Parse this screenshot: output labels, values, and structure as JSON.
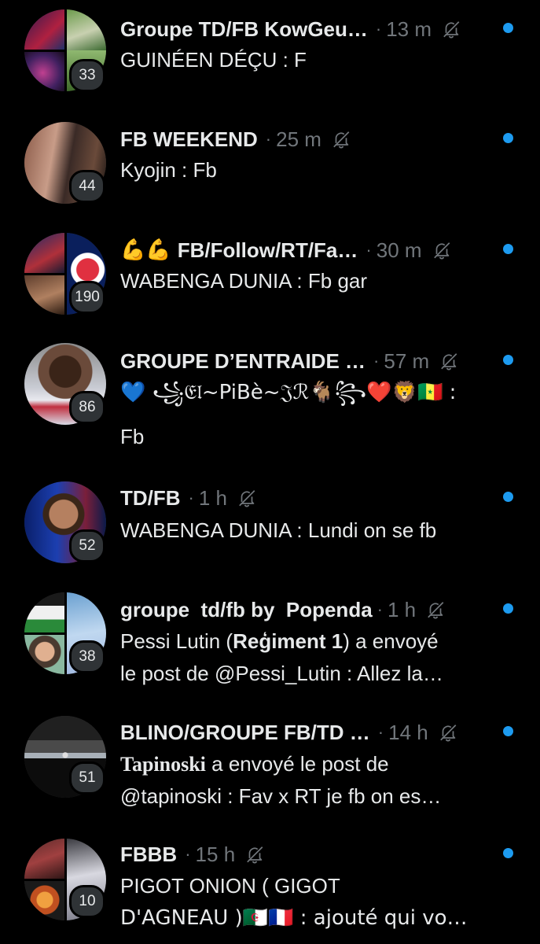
{
  "conversations": [
    {
      "name": "Groupe TD/FB KowGeu…",
      "time": "13 m",
      "count": "33",
      "sender": "GUINÉEN DÉÇU",
      "preview": " : F"
    },
    {
      "name": "FB WEEKEND",
      "time": "25 m",
      "count": "44",
      "sender": "Kyojin",
      "preview": " : Fb"
    },
    {
      "name": "FB/Follow/RT/Fa…",
      "emoji_prefix": "💪💪",
      "time": "30 m",
      "count": "190",
      "sender": "WABENGA DUNIA",
      "preview": " : Fb gar"
    },
    {
      "name": "GROUPE D’ENTRAIDE …",
      "time": "57 m",
      "count": "86",
      "sender_line1": "💙 ꧁𝔈𝔩~PiBè~𝔍ℛ🐐꧂❤️🦁🇸🇳 :",
      "sender_line2": "Fb"
    },
    {
      "name": "TD/FB",
      "time": "1 h",
      "count": "52",
      "sender": "WABENGA DUNIA",
      "preview": " : Lundi on se fb"
    },
    {
      "name": "groupe  td/fb by  Popenda",
      "time": "1 h",
      "count": "38",
      "line1_a": "Pessi Lutin (",
      "line1_b": "Reģiment 1",
      "line1_c": ") a envoyé",
      "line2": "le post de @Pessi_Lutin : Allez la…"
    },
    {
      "name": "BLINO/GROUPE FB/TD …",
      "time": "14 h",
      "count": "51",
      "line1_a": "Tapinoski",
      "line1_b": " a envoyé le post de",
      "line2": "@tapinoski : Fav x RT je fb on es…"
    },
    {
      "name": "FBBB",
      "time": "15 h",
      "count": "10",
      "line1": "PIGOT ONION ( GIGOT",
      "line2": "D'AGNEAU )🇩🇿🇫🇷 : ajouté qui vo…"
    }
  ],
  "icons": {
    "mute": "bell-slash-icon",
    "unread": "unread-dot"
  },
  "colors": {
    "background": "#000000",
    "text": "#e7e9ea",
    "muted": "#71767b",
    "accent": "#1d9bf0",
    "badge": "#2f3336"
  }
}
